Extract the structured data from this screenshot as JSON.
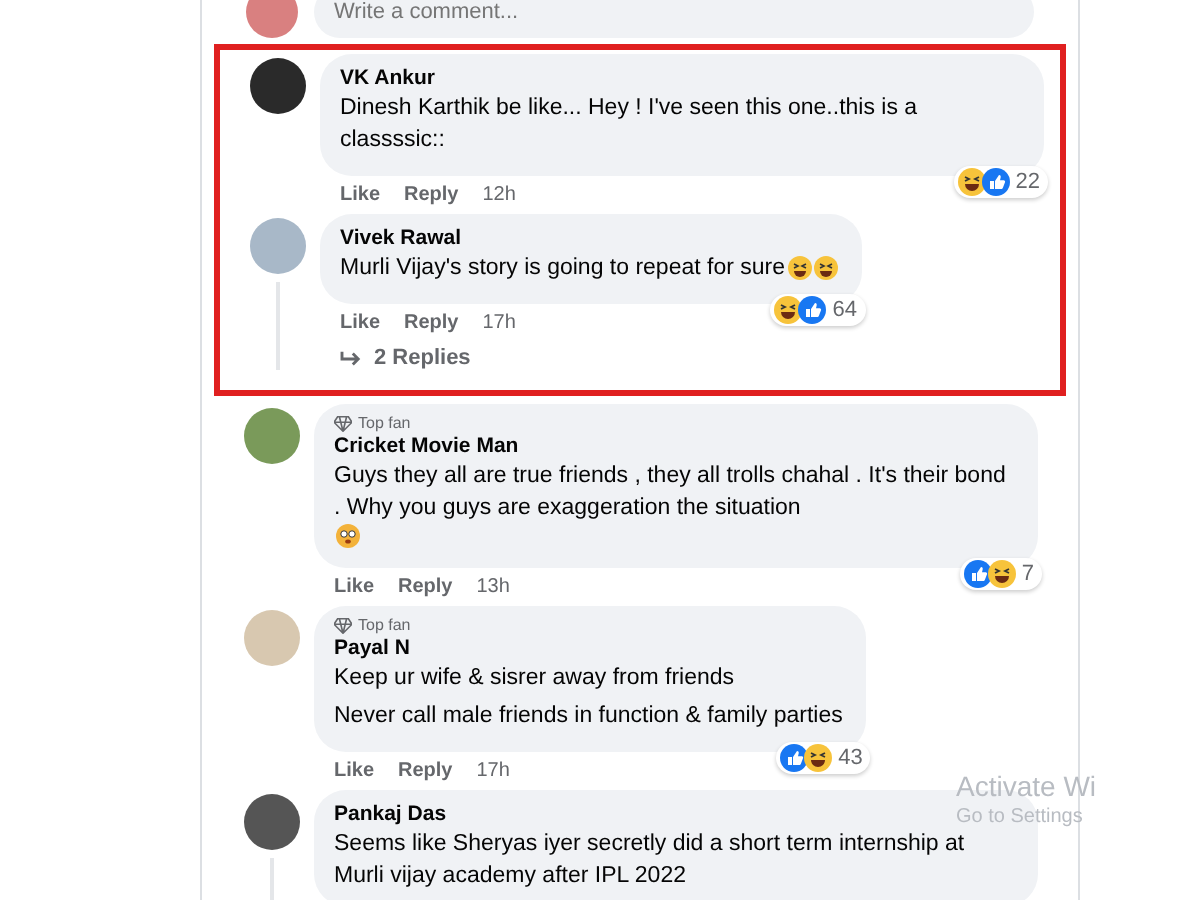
{
  "composer": {
    "placeholder": "Write a comment..."
  },
  "highlighted_comments": [
    {
      "name": "VK Ankur",
      "lines": [
        "Dinesh Karthik be like... Hey ! I've seen this one..this is a classssic::"
      ],
      "reactions": [
        {
          "kind": "haha"
        },
        {
          "kind": "like"
        }
      ],
      "reaction_count": "22",
      "like": "Like",
      "reply": "Reply",
      "time": "12h",
      "thread": false
    },
    {
      "name": "Vivek Rawal",
      "lines": [
        "Murli Vijay's story is going to repeat for sure"
      ],
      "trailing_emoji": [
        {
          "kind": "squint"
        },
        {
          "kind": "squint"
        }
      ],
      "reactions": [
        {
          "kind": "haha"
        },
        {
          "kind": "like"
        }
      ],
      "reaction_count": "64",
      "like": "Like",
      "reply": "Reply",
      "time": "17h",
      "replies": "2 Replies",
      "thread": true
    }
  ],
  "comments": [
    {
      "name": "Cricket Movie Man",
      "badge": "Top fan",
      "lines": [
        "Guys they all are true friends , they all trolls chahal . It's their bond . Why you guys are exaggeration the situation"
      ],
      "trailing_emoji": [
        {
          "kind": "dizzy"
        }
      ],
      "reactions": [
        {
          "kind": "like"
        },
        {
          "kind": "haha"
        }
      ],
      "reaction_count": "7",
      "like": "Like",
      "reply": "Reply",
      "time": "13h",
      "thread": false
    },
    {
      "name": "Payal N",
      "badge": "Top fan",
      "lines": [
        "Keep ur wife & sisrer away from friends",
        "Never call male friends in function & family parties"
      ],
      "reactions": [
        {
          "kind": "like"
        },
        {
          "kind": "haha"
        }
      ],
      "reaction_count": "43",
      "like": "Like",
      "reply": "Reply",
      "time": "17h",
      "thread": false
    },
    {
      "name": "Pankaj Das",
      "lines": [
        "Seems like Sheryas iyer secretly did a short term internship at Murli vijay academy after IPL 2022"
      ],
      "thread": true
    }
  ],
  "overlay": {
    "title": "Activate Wi",
    "subtitle": "Go to Settings"
  }
}
